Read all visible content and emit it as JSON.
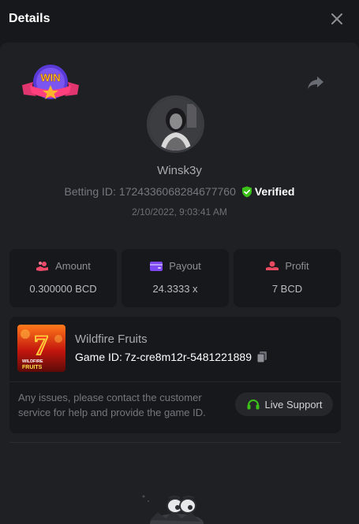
{
  "header": {
    "title": "Details"
  },
  "player": {
    "username": "Winsk3y",
    "betting_id_label": "Betting ID:",
    "betting_id": "1724336068284677760",
    "verified_label": "Verified",
    "timestamp": "2/10/2022, 9:03:41 AM"
  },
  "badge": {
    "text": "WIN"
  },
  "stats": {
    "amount_label": "Amount",
    "amount_value": "0.300000 BCD",
    "payout_label": "Payout",
    "payout_value": "24.3333 x",
    "profit_label": "Profit",
    "profit_value": "7 BCD"
  },
  "game": {
    "name": "Wildfire Fruits",
    "id_label": "Game ID:",
    "id_value": "7z-cre8m12r-5481221889",
    "thumb_number": "7",
    "thumb_line1": "WILDFIRE",
    "thumb_line2": "FRUITS"
  },
  "support": {
    "issue_text": "Any issues, please contact the customer service for help and provide the game ID.",
    "button_label": "Live Support"
  },
  "colors": {
    "background": "#17181b",
    "card": "#1f2024",
    "verified_green": "#3bc117",
    "amount_icon": "#ed4a6a",
    "payout_icon": "#7d48f0",
    "profit_icon": "#e84a5f"
  },
  "icons": {
    "close": "close-icon",
    "share": "share-icon",
    "verified": "shield-check-icon",
    "amount": "coins-hand-icon",
    "payout": "wallet-card-icon",
    "profit": "hand-profit-icon",
    "copy": "copy-icon",
    "support": "headset-icon"
  }
}
